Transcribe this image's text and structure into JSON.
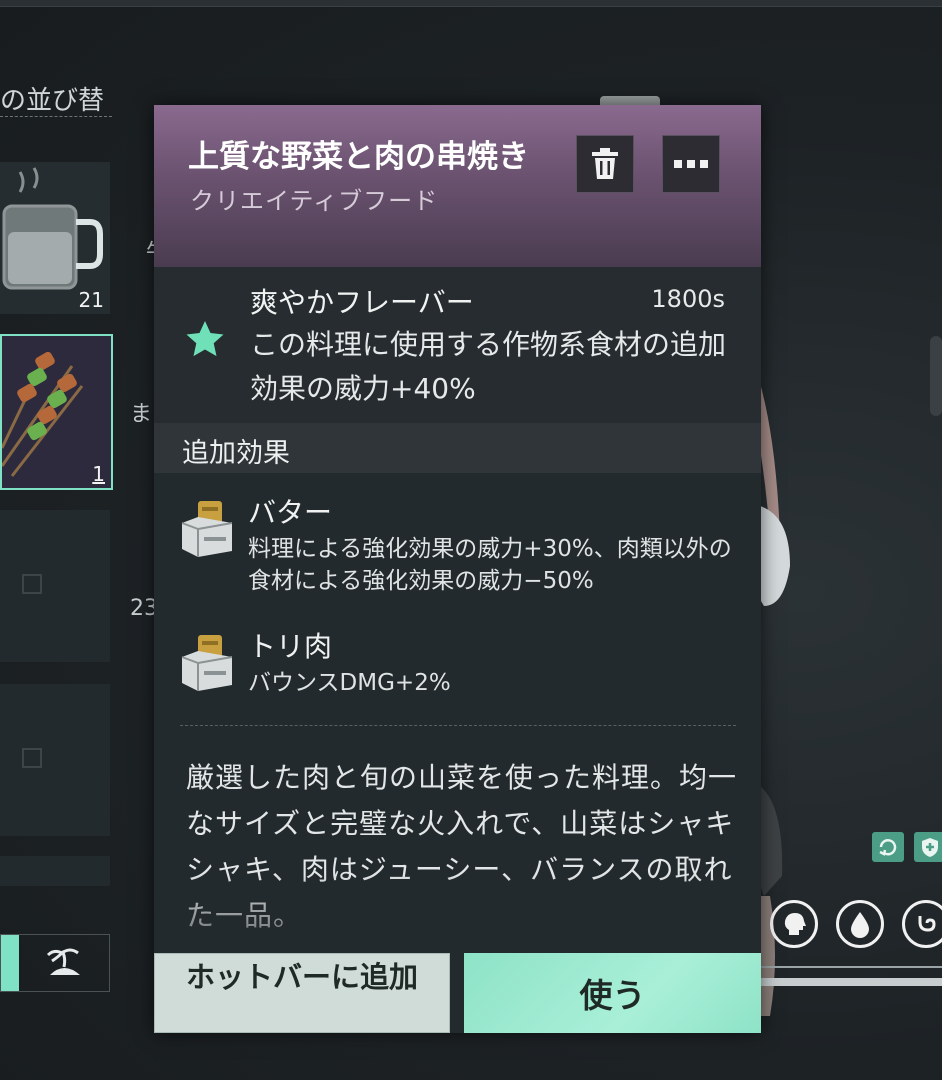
{
  "inventory": {
    "sort_label": "の並び替",
    "slots": [
      {
        "count": "21",
        "icon": "water-mug-icon"
      },
      {
        "count": "1",
        "icon": "skewer-food-icon"
      }
    ],
    "side_texts": [
      "牛",
      "ま",
      "23"
    ],
    "tabs": {
      "active_color": "#7fe2c4",
      "island_icon": "island-icon"
    }
  },
  "item": {
    "name": "上質な野菜と肉の串焼き",
    "category": "クリエイティブフード",
    "header_color": "#6d5472",
    "actions": {
      "delete_icon": "trash-icon",
      "more_icon": "more-icon"
    }
  },
  "flavor": {
    "name": "爽やかフレーバー",
    "duration": "1800s",
    "description": "この料理に使用する作物系食材の追加効果の威力+40%",
    "icon": "star-icon",
    "icon_color": "#6fe0b8"
  },
  "extra_effects": {
    "header": "追加効果",
    "items": [
      {
        "name": "バター",
        "description": "料理による強化効果の威力+30%、肉類以外の食材による強化効果の威力−50%",
        "icon": "ingredient-crate-icon"
      },
      {
        "name": "トリ肉",
        "description": "バウンスDMG+2%",
        "icon": "ingredient-crate-icon"
      }
    ]
  },
  "lore": "厳選した肉と旬の山菜を使った料理。均一なサイズと完璧な火入れで、山菜はシャキシャキ、肉はジューシー、バランスの取れた一品。",
  "buttons": {
    "hotbar": "ホットバーに追加",
    "use": "使う",
    "use_color": "#8ee3c7"
  },
  "status": {
    "icons": [
      "head-icon",
      "water-drop-icon",
      "stomach-icon"
    ],
    "buffs": [
      "regen-buff-icon",
      "shield-buff-icon"
    ]
  }
}
